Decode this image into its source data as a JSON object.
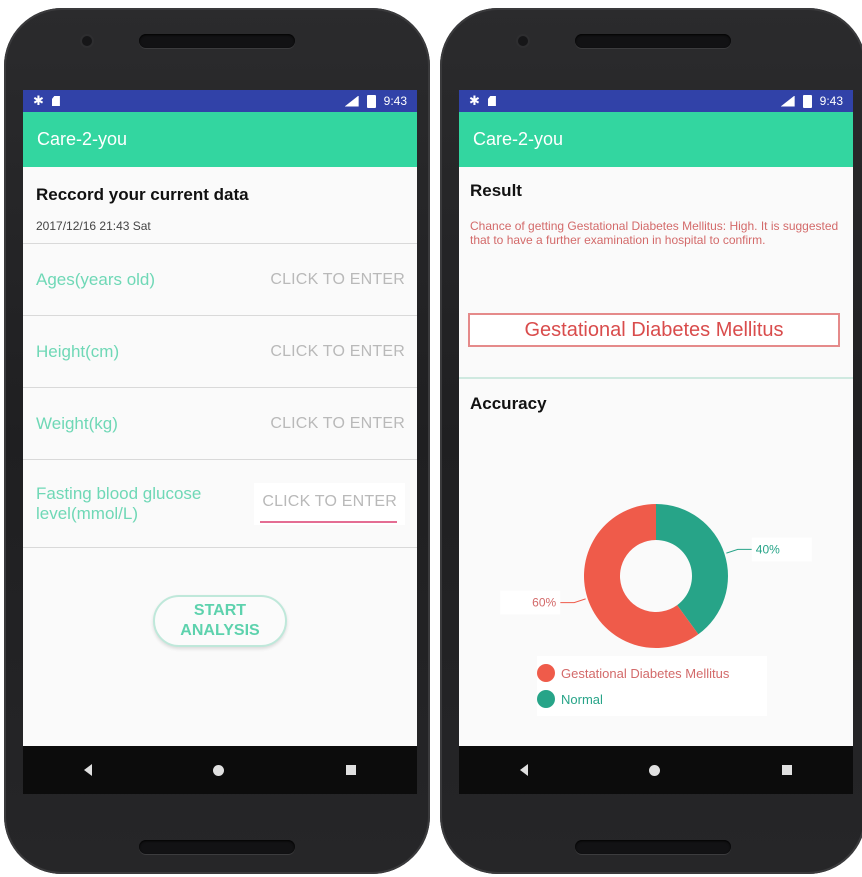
{
  "status": {
    "time": "9:43"
  },
  "app": {
    "title": "Care-2-you"
  },
  "record": {
    "title": "Reccord your current data",
    "date": "2017/12/16 21:43 Sat",
    "fields": [
      {
        "label": "Ages(years old)",
        "action": "CLICK TO ENTER"
      },
      {
        "label": "Height(cm)",
        "action": "CLICK TO ENTER"
      },
      {
        "label": "Weight(kg)",
        "action": "CLICK TO ENTER"
      },
      {
        "label": "Fasting blood glucose level(mmol/L)",
        "action": "CLICK TO ENTER"
      }
    ],
    "start_button": "START ANALYSIS"
  },
  "result": {
    "title": "Result",
    "description": "Chance of getting Gestational Diabetes Mellitus: High. It is suggested that to have a further examination in hospital to confirm.",
    "diagnosis": "Gestational Diabetes Mellitus",
    "accuracy_title": "Accuracy"
  },
  "colors": {
    "accent": "#33d6a0",
    "status_bar": "#3142a8",
    "gdm": "#ef5b4a",
    "normal": "#27a488"
  },
  "chart_data": {
    "type": "pie",
    "donut": true,
    "title": "",
    "slices": [
      {
        "label": "Gestational Diabetes Mellitus",
        "value": 60,
        "display": "60%",
        "color": "#ef5b4a"
      },
      {
        "label": "Normal",
        "value": 40,
        "display": "40%",
        "color": "#27a488"
      }
    ],
    "legend_placement": "bottom"
  }
}
